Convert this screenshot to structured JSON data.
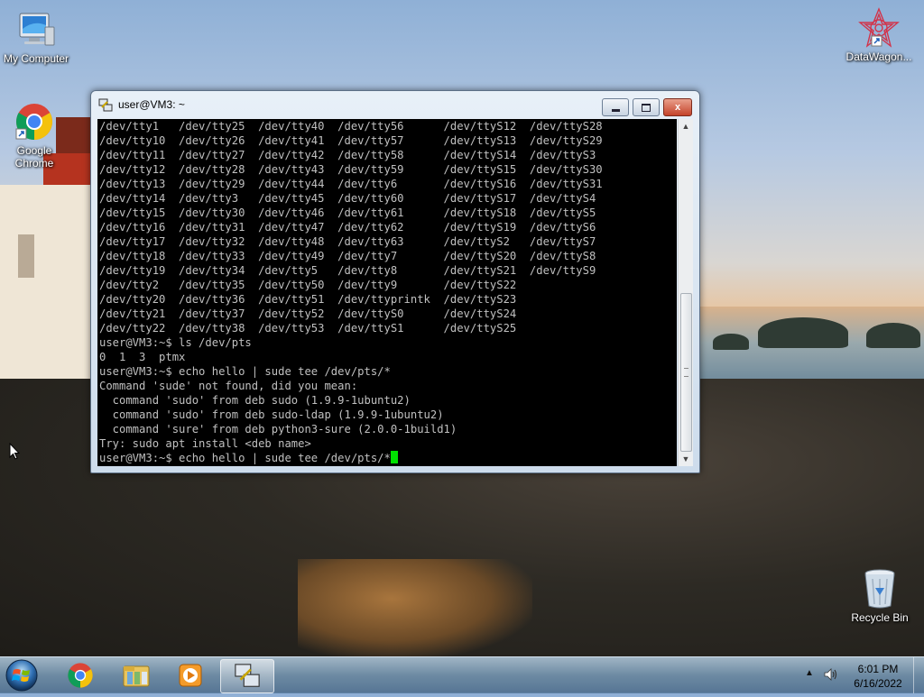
{
  "desktop": {
    "icons": [
      {
        "label": "My Computer"
      },
      {
        "label": "Google Chrome"
      },
      {
        "label": "DataWagon..."
      },
      {
        "label": "Recycle Bin"
      }
    ]
  },
  "window": {
    "title": "user@VM3: ~",
    "minimize_icon": "minimize-icon",
    "maximize_icon": "maximize-icon",
    "close_label": "x"
  },
  "terminal": {
    "lines": [
      "/dev/tty1   /dev/tty25  /dev/tty40  /dev/tty56      /dev/ttyS12  /dev/ttyS28",
      "/dev/tty10  /dev/tty26  /dev/tty41  /dev/tty57      /dev/ttyS13  /dev/ttyS29",
      "/dev/tty11  /dev/tty27  /dev/tty42  /dev/tty58      /dev/ttyS14  /dev/ttyS3",
      "/dev/tty12  /dev/tty28  /dev/tty43  /dev/tty59      /dev/ttyS15  /dev/ttyS30",
      "/dev/tty13  /dev/tty29  /dev/tty44  /dev/tty6       /dev/ttyS16  /dev/ttyS31",
      "/dev/tty14  /dev/tty3   /dev/tty45  /dev/tty60      /dev/ttyS17  /dev/ttyS4",
      "/dev/tty15  /dev/tty30  /dev/tty46  /dev/tty61      /dev/ttyS18  /dev/ttyS5",
      "/dev/tty16  /dev/tty31  /dev/tty47  /dev/tty62      /dev/ttyS19  /dev/ttyS6",
      "/dev/tty17  /dev/tty32  /dev/tty48  /dev/tty63      /dev/ttyS2   /dev/ttyS7",
      "/dev/tty18  /dev/tty33  /dev/tty49  /dev/tty7       /dev/ttyS20  /dev/ttyS8",
      "/dev/tty19  /dev/tty34  /dev/tty5   /dev/tty8       /dev/ttyS21  /dev/ttyS9",
      "/dev/tty2   /dev/tty35  /dev/tty50  /dev/tty9       /dev/ttyS22",
      "/dev/tty20  /dev/tty36  /dev/tty51  /dev/ttyprintk  /dev/ttyS23",
      "/dev/tty21  /dev/tty37  /dev/tty52  /dev/ttyS0      /dev/ttyS24",
      "/dev/tty22  /dev/tty38  /dev/tty53  /dev/ttyS1      /dev/ttyS25",
      "user@VM3:~$ ls /dev/pts",
      "0  1  3  ptmx",
      "user@VM3:~$ echo hello | sude tee /dev/pts/*",
      "Command 'sude' not found, did you mean:",
      "  command 'sudo' from deb sudo (1.9.9-1ubuntu2)",
      "  command 'sudo' from deb sudo-ldap (1.9.9-1ubuntu2)",
      "  command 'sure' from deb python3-sure (2.0.0-1build1)",
      "Try: sudo apt install <deb name>"
    ],
    "prompt_line": "user@VM3:~$ echo hello | sude tee /dev/pts/*"
  },
  "taskbar": {
    "items": [
      "start-orb",
      "chrome",
      "file-explorer",
      "media-player",
      "putty"
    ],
    "clock_time": "6:01 PM",
    "clock_date": "6/16/2022"
  }
}
